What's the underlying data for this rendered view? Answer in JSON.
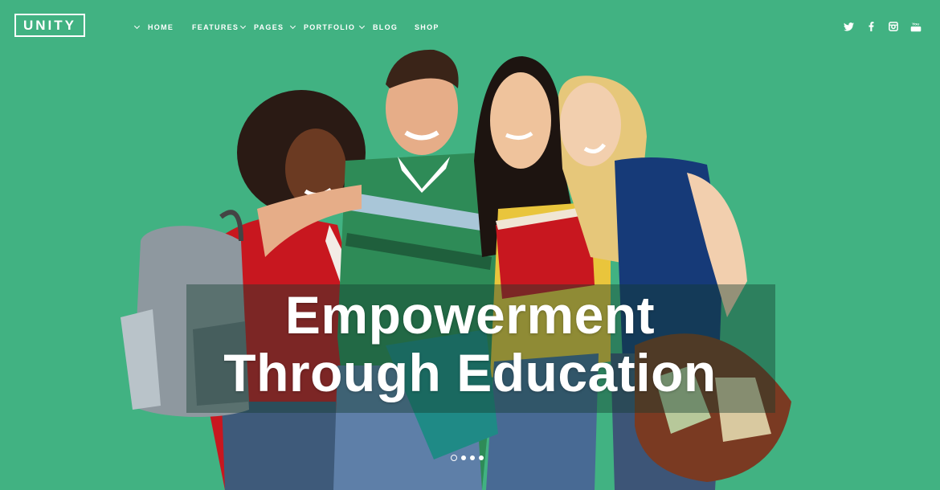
{
  "brand": {
    "logo_text": "UNITY"
  },
  "nav": {
    "items": [
      {
        "label": "HOME",
        "has_dropdown": true
      },
      {
        "label": "FEATURES",
        "has_dropdown": false
      },
      {
        "label": "PAGES",
        "has_dropdown": true
      },
      {
        "label": "PORTFOLIO",
        "has_dropdown": true
      },
      {
        "label": "BLOG",
        "has_dropdown": true
      },
      {
        "label": "SHOP",
        "has_dropdown": false
      }
    ]
  },
  "social": {
    "icons": [
      "twitter-icon",
      "facebook-icon",
      "instagram-icon",
      "youtube-icon"
    ],
    "youtube_label": "You"
  },
  "hero": {
    "headline_line1": "Empowerment",
    "headline_line2": "Through Education",
    "background_color": "#41b282",
    "slides_total": 4,
    "active_slide": 1
  }
}
